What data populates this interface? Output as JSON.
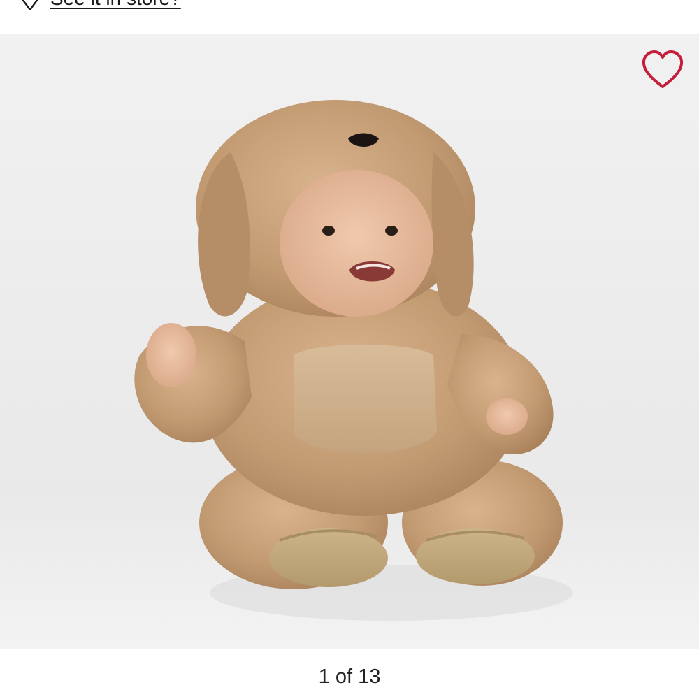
{
  "store_link": {
    "label": "See it in store?",
    "icon": "map-pin-icon"
  },
  "gallery": {
    "favorite_icon": "heart-outline-icon",
    "favorite_color": "#c41e3a",
    "current_index": 1,
    "total": 13,
    "counter_text": "1 of 13"
  }
}
